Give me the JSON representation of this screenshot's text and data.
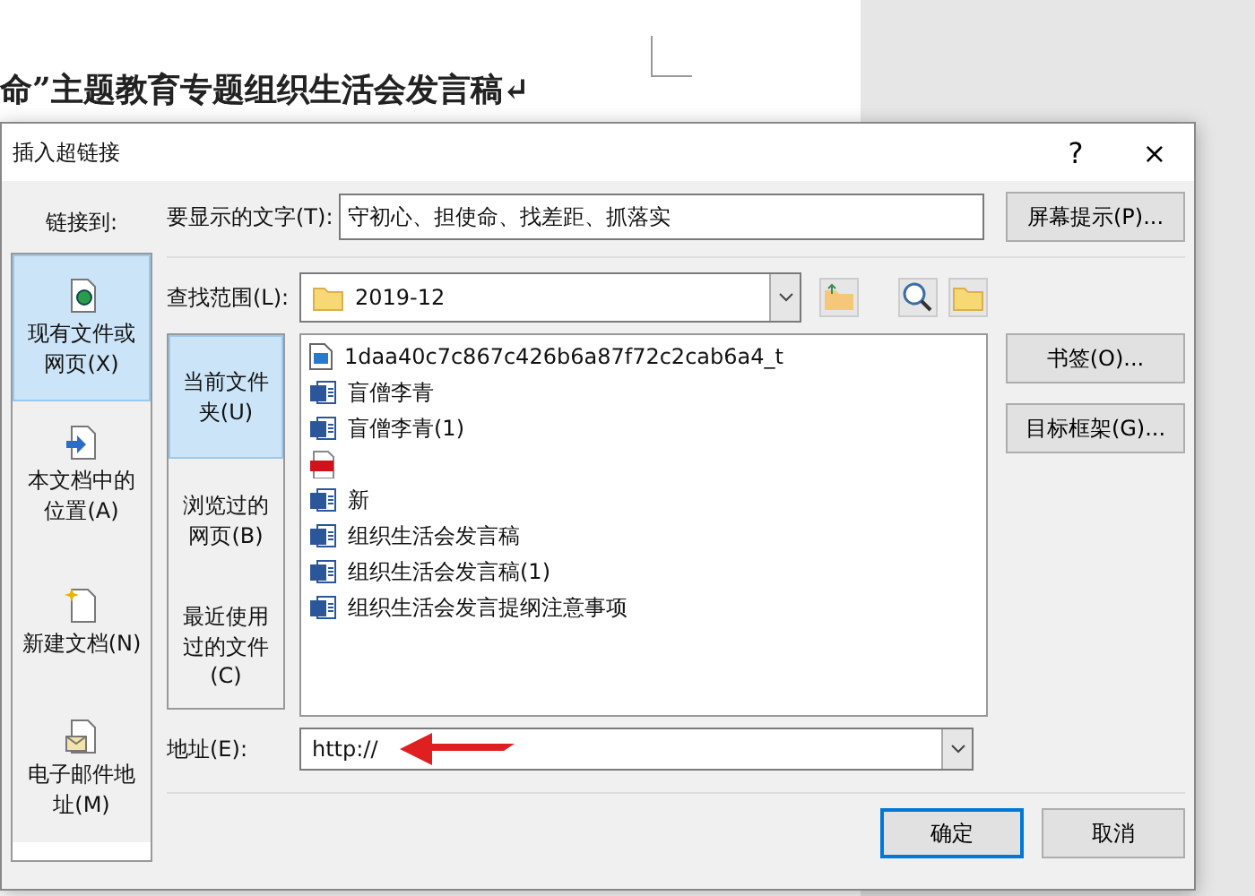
{
  "document": {
    "heading": "命”主题教育专题组织生活会发言稿↵"
  },
  "dialog": {
    "title": "插入超链接",
    "help": "?",
    "close": "×",
    "link_to_label": "链接到:",
    "link_targets": [
      {
        "kind": "file",
        "label": "现有文件或网页(X)",
        "selected": true
      },
      {
        "kind": "place",
        "label": "本文档中的位置(A)",
        "selected": false
      },
      {
        "kind": "new",
        "label": "新建文档(N)",
        "selected": false
      },
      {
        "kind": "email",
        "label": "电子邮件地址(M)",
        "selected": false
      }
    ],
    "display_text": {
      "label": "要显示的文字(T):",
      "value": "守初心、担使命、找差距、抓落实"
    },
    "screen_tip_button": "屏幕提示(P)...",
    "look_in": {
      "label": "查找范围(L):",
      "value": "2019-12"
    },
    "sources": [
      {
        "label": "当前文件夹(U)",
        "selected": true
      },
      {
        "label": "浏览过的网页(B)",
        "selected": false
      },
      {
        "label": "最近使用过的文件(C)",
        "selected": false
      }
    ],
    "files": [
      {
        "kind": "image",
        "name": "1daa40c7c867c426b6a87f72c2cab6a4_t"
      },
      {
        "kind": "word",
        "name": "盲僧李青"
      },
      {
        "kind": "word",
        "name": "盲僧李青(1)"
      },
      {
        "kind": "pdf"
      },
      {
        "kind": "word",
        "name": "新"
      },
      {
        "kind": "word",
        "name": "组织生活会发言稿"
      },
      {
        "kind": "word",
        "name": "组织生活会发言稿(1)"
      },
      {
        "kind": "word",
        "name": "组织生活会发言提纲注意事项"
      }
    ],
    "side_buttons": [
      "书签(O)...",
      "目标框架(G)..."
    ],
    "address": {
      "label": "地址(E):",
      "value": "http://"
    },
    "ok_button": "确定",
    "cancel_button": "取消"
  }
}
